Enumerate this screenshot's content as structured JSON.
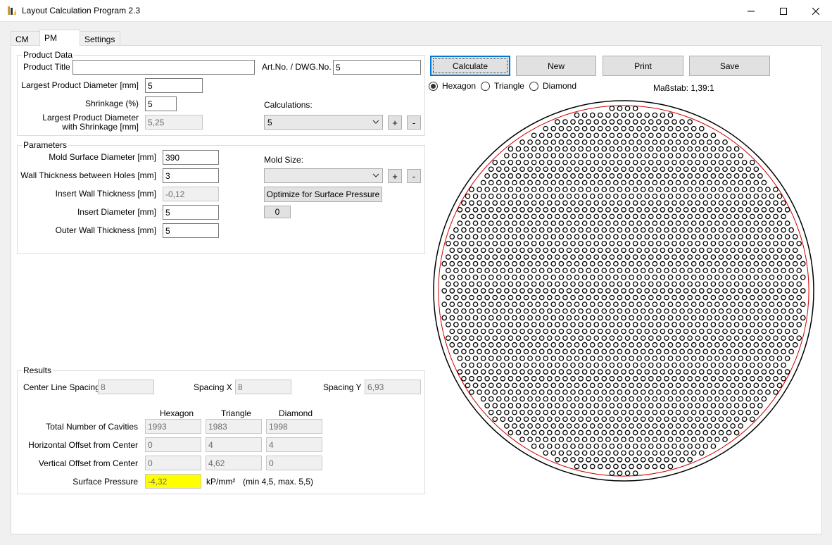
{
  "window": {
    "title": "Layout Calculation Program 2.3",
    "minimize_icon": "minimize-icon",
    "maximize_icon": "maximize-icon",
    "close_icon": "close-icon"
  },
  "tabs": [
    {
      "label": "CM",
      "active": false
    },
    {
      "label": "PM",
      "active": true
    },
    {
      "label": "Settings",
      "active": false
    }
  ],
  "product_data": {
    "title": "Product Data",
    "product_title_label": "Product Title",
    "product_title_value": "",
    "artno_label": "Art.No. / DWG.No.",
    "artno_value": "5",
    "largest_diameter_label": "Largest Product Diameter [mm]",
    "largest_diameter_value": "5",
    "shrinkage_label": "Shrinkage (%)",
    "shrinkage_value": "5",
    "with_shrinkage_label_1": "Largest Product Diameter",
    "with_shrinkage_label_2": "with Shrinkage [mm]",
    "with_shrinkage_value": "5,25",
    "calculations_label": "Calculations:",
    "calculations_value": "5",
    "plus": "+",
    "minus": "-"
  },
  "parameters": {
    "title": "Parameters",
    "mold_surface_label": "Mold Surface Diameter [mm]",
    "mold_surface_value": "390",
    "wall_between_label": "Wall Thickness between Holes [mm]",
    "wall_between_value": "3",
    "insert_wall_label": "Insert Wall Thickness [mm]",
    "insert_wall_value": "-0,12",
    "insert_diameter_label": "Insert Diameter [mm]",
    "insert_diameter_value": "5",
    "outer_wall_label": "Outer Wall Thickness [mm]",
    "outer_wall_value": "5",
    "mold_size_label": "Mold Size:",
    "mold_size_value": "",
    "plus": "+",
    "minus": "-",
    "optimize_label": "Optimize for Surface Pressure",
    "counter_value": "0"
  },
  "results": {
    "title": "Results",
    "center_line_label": "Center Line Spacing",
    "center_line_value": "8",
    "spacing_x_label": "Spacing X",
    "spacing_x_value": "8",
    "spacing_y_label": "Spacing Y",
    "spacing_y_value": "6,93",
    "col_hexagon": "Hexagon",
    "col_triangle": "Triangle",
    "col_diamond": "Diamond",
    "total_label": "Total Number of Cavities",
    "total": [
      "1993",
      "1983",
      "1998"
    ],
    "hoffset_label": "Horizontal Offset from Center",
    "hoffset": [
      "0",
      "4",
      "4"
    ],
    "voffset_label": "Vertical Offset from Center",
    "voffset": [
      "0",
      "4,62",
      "0"
    ],
    "pressure_label": "Surface Pressure",
    "pressure_value": "-4,32",
    "pressure_unit": "kP/mm²",
    "pressure_range": "(min 4,5, max. 5,5)"
  },
  "actions": {
    "calculate": "Calculate",
    "new": "New",
    "print": "Print",
    "save": "Save"
  },
  "pattern": {
    "options": [
      {
        "label": "Hexagon",
        "selected": true
      },
      {
        "label": "Triangle",
        "selected": false
      },
      {
        "label": "Diamond",
        "selected": false
      }
    ],
    "scale": "Maßstab: 1,39:1"
  },
  "layout_drawing": {
    "mold_surface_diameter_mm": 390,
    "usable_diameter_mm": 380,
    "cavity_diameter_mm": 5,
    "spacing_x_mm": 8,
    "spacing_y_mm": 6.93,
    "outer_circle_color": "#000000",
    "usable_circle_color": "#d00000",
    "cavity_color": "#000000"
  },
  "colors": {
    "accent": "#0078d7",
    "highlight": "#ffff00"
  }
}
